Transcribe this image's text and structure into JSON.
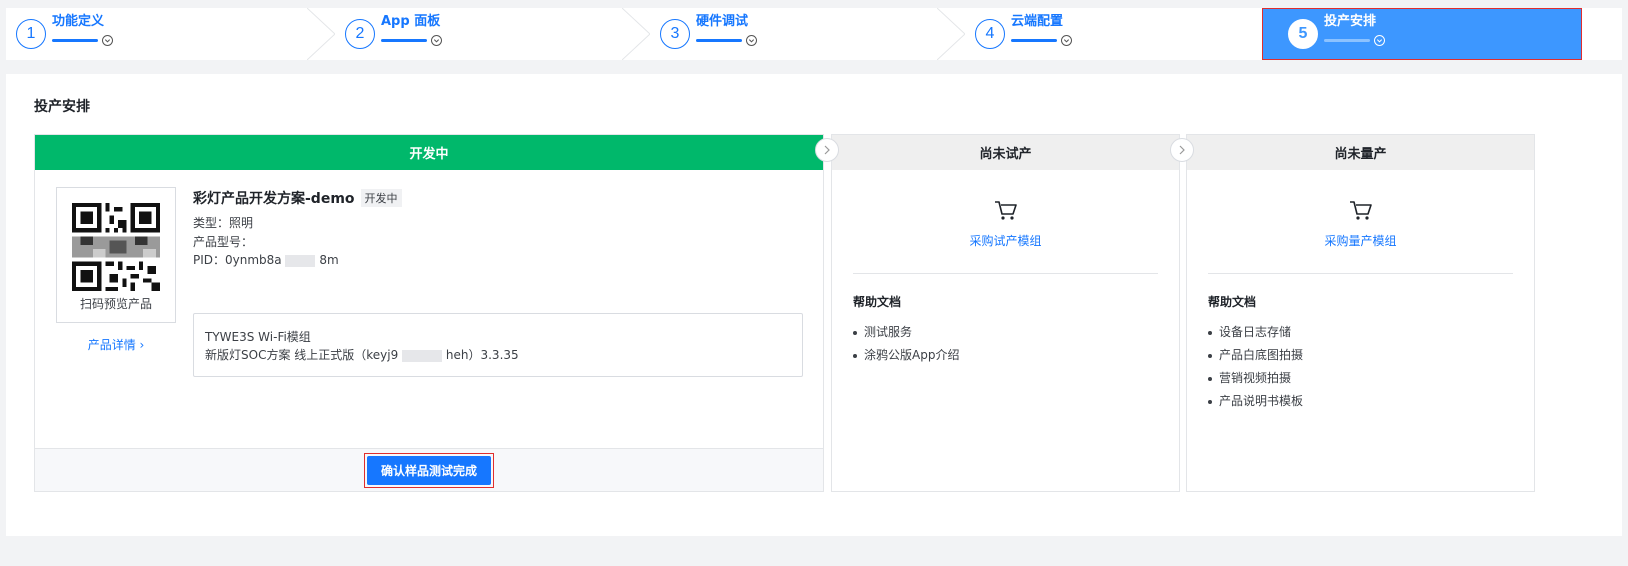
{
  "stepper": {
    "steps": [
      {
        "num": "1",
        "label": "功能定义"
      },
      {
        "num": "2",
        "label": "App 面板"
      },
      {
        "num": "3",
        "label": "硬件调试"
      },
      {
        "num": "4",
        "label": "云端配置"
      },
      {
        "num": "5",
        "label": "投产安排"
      }
    ],
    "active_index": 5
  },
  "section_title": "投产安排",
  "columns": {
    "dev": {
      "header": "开发中",
      "qr_label": "扫码预览产品",
      "detail_link": "产品详情 ›",
      "product_name": "彩灯产品开发方案-demo",
      "status_badge": "开发中",
      "type_line": "类型：照明",
      "model_line": "产品型号：",
      "pid_prefix": "PID：0ynmb8a",
      "pid_suffix": "8m",
      "module_name": "TYWE3S Wi-Fi模组",
      "firmware_prefix": "新版灯SOC方案 线上正式版（keyj9",
      "firmware_suffix": "heh）3.3.35",
      "confirm_button": "确认样品测试完成"
    },
    "trial": {
      "header": "尚未试产",
      "buy_link": "采购试产模组",
      "help_title": "帮助文档",
      "help_items": [
        "测试服务",
        "涂鸦公版App介绍"
      ]
    },
    "mass": {
      "header": "尚未量产",
      "buy_link": "采购量产模组",
      "help_title": "帮助文档",
      "help_items": [
        "设备日志存储",
        "产品白底图拍摄",
        "营销视频拍摄",
        "产品说明书模板"
      ]
    }
  },
  "colors": {
    "accent": "#1677ff",
    "active_step_bg": "#3d97ff",
    "dev_header_bg": "#00b86b",
    "highlight_border": "#e02e2e"
  }
}
